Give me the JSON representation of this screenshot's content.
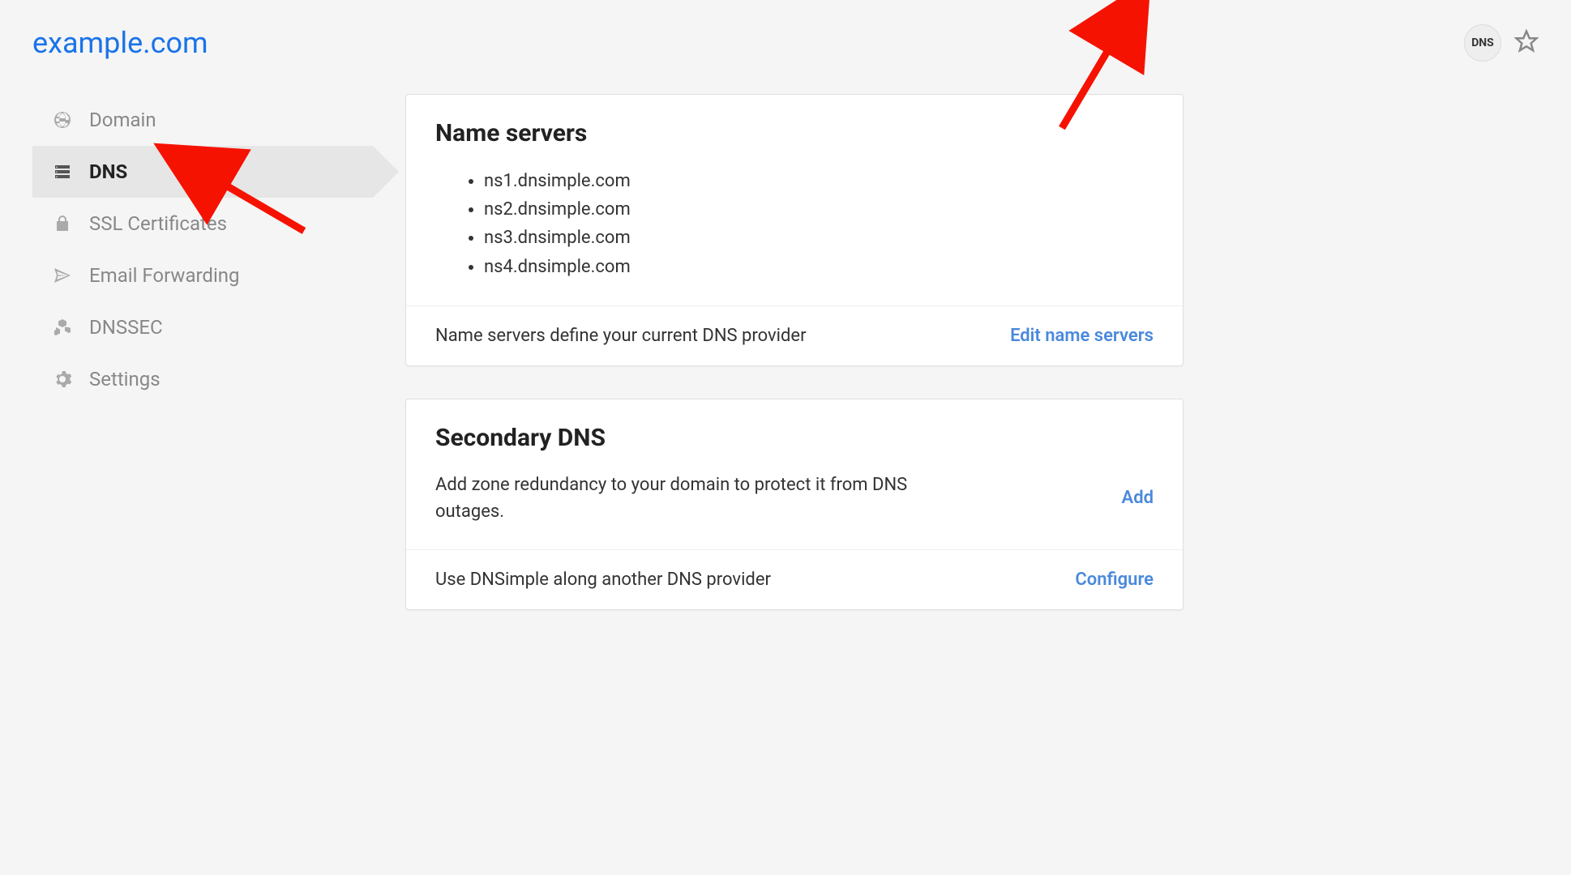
{
  "header": {
    "domain_title": "example.com",
    "dns_badge": "DNS"
  },
  "sidebar": {
    "items": [
      {
        "label": "Domain"
      },
      {
        "label": "DNS"
      },
      {
        "label": "SSL Certificates"
      },
      {
        "label": "Email Forwarding"
      },
      {
        "label": "DNSSEC"
      },
      {
        "label": "Settings"
      }
    ]
  },
  "cards": {
    "name_servers": {
      "title": "Name servers",
      "servers": [
        "ns1.dnsimple.com",
        "ns2.dnsimple.com",
        "ns3.dnsimple.com",
        "ns4.dnsimple.com"
      ],
      "footer_text": "Name servers define your current DNS provider",
      "footer_action": "Edit name servers"
    },
    "secondary_dns": {
      "title": "Secondary DNS",
      "description": "Add zone redundancy to your domain to protect it from DNS outages.",
      "action_add": "Add",
      "footer_text": "Use DNSimple along another DNS provider",
      "footer_action": "Configure"
    }
  }
}
